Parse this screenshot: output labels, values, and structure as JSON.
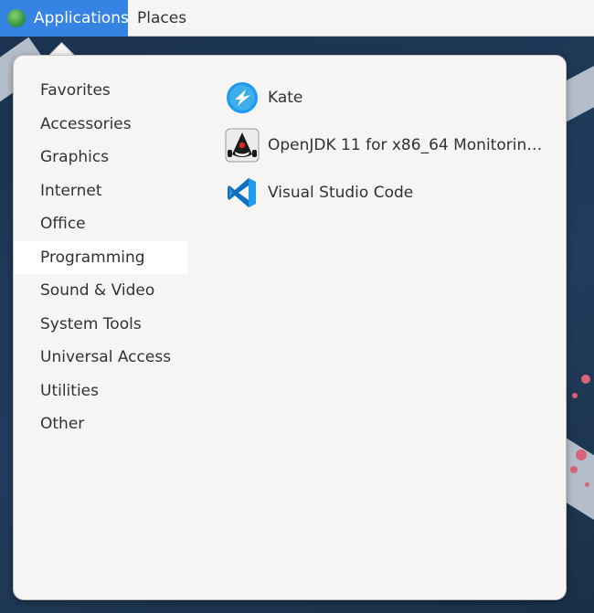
{
  "panel": {
    "applications_label": "Applications",
    "places_label": "Places",
    "accent_color": "#3584e4"
  },
  "categories": [
    {
      "label": "Favorites"
    },
    {
      "label": "Accessories"
    },
    {
      "label": "Graphics"
    },
    {
      "label": "Internet"
    },
    {
      "label": "Office"
    },
    {
      "label": "Programming",
      "selected": true
    },
    {
      "label": "Sound & Video"
    },
    {
      "label": "System Tools"
    },
    {
      "label": "Universal Access"
    },
    {
      "label": "Utilities"
    },
    {
      "label": "Other"
    }
  ],
  "apps": [
    {
      "label": "Kate",
      "icon": "kate-icon"
    },
    {
      "label": "OpenJDK 11 for x86_64 Monitorin…",
      "icon": "java-duke-icon"
    },
    {
      "label": "Visual Studio Code",
      "icon": "vscode-icon"
    }
  ]
}
